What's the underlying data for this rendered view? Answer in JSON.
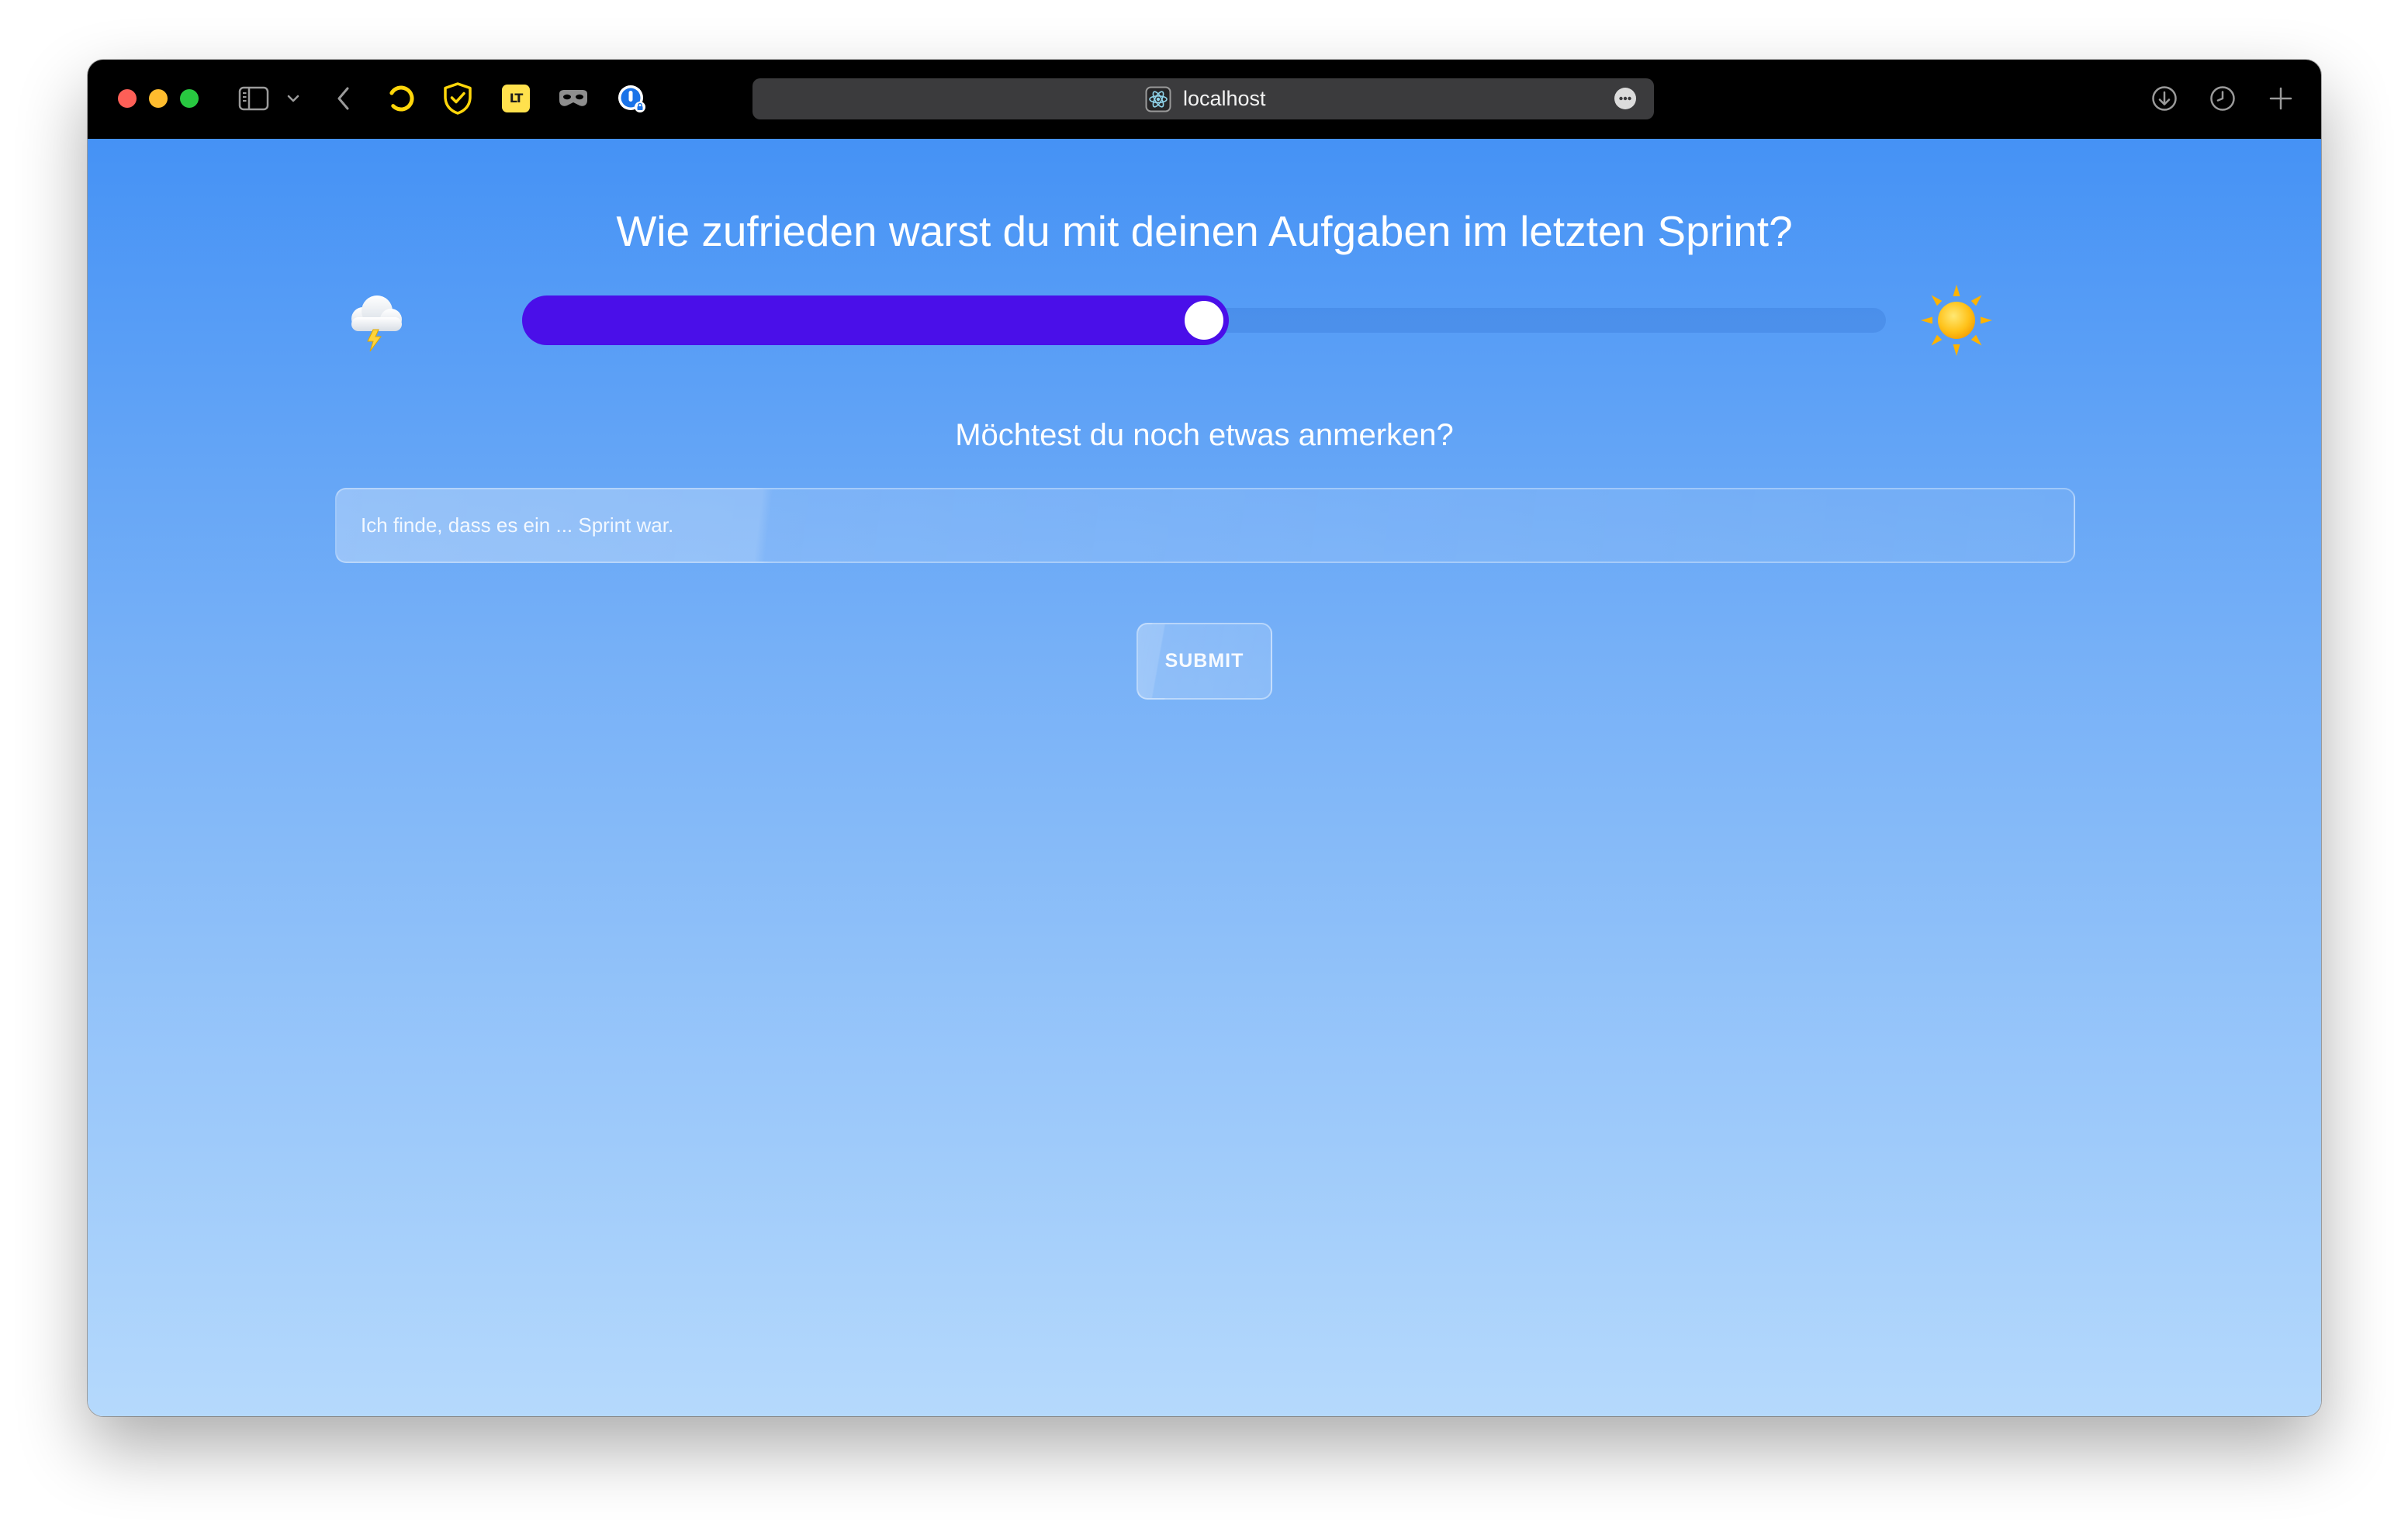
{
  "browser": {
    "address": "localhost",
    "lt_logo_text": "LT",
    "toolbar_icons": [
      "sidebar-icon",
      "chevron-down-icon",
      "back-arrow-icon",
      "loading-spinner-icon",
      "shield-check-icon",
      "languagetool-icon",
      "mask-icon",
      "password-manager-icon",
      "react-site-icon",
      "more-options-icon",
      "download-icon",
      "history-clock-icon",
      "new-tab-plus-icon"
    ]
  },
  "survey": {
    "question": "Wie zufrieden warst du mit deinen Aufgaben im letzten Sprint?",
    "satisfaction_level": 0.5,
    "low_icon": "thunder-cloud-icon",
    "high_icon": "sun-icon",
    "comment_prompt": "Möchtest du noch etwas anmerken?",
    "comment_placeholder": "Ich finde, dass es ein ... Sprint war.",
    "submit_label": "SUBMIT"
  },
  "colors": {
    "titlebar": "#000000",
    "background_top": "#4592f5",
    "background_bottom": "#b5d9fc",
    "slider_fill": "#4a0fe9",
    "text": "#ffffff"
  }
}
